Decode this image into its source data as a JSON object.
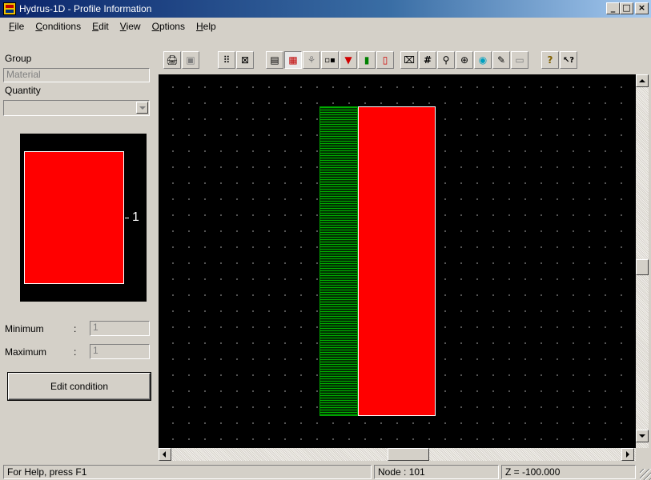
{
  "window": {
    "title": "Hydrus-1D - Profile Information",
    "controls": {
      "minimize": "_",
      "maximize": "□",
      "close": "×"
    }
  },
  "menu": {
    "items": [
      {
        "label": "File",
        "underline": "F",
        "rest": "ile"
      },
      {
        "label": "Conditions",
        "underline": "C",
        "rest": "onditions"
      },
      {
        "label": "Edit",
        "underline": "E",
        "rest": "dit"
      },
      {
        "label": "View",
        "underline": "V",
        "rest": "iew"
      },
      {
        "label": "Options",
        "underline": "O",
        "rest": "ptions"
      },
      {
        "label": "Help",
        "underline": "H",
        "rest": "elp"
      }
    ]
  },
  "left_panel": {
    "group_label": "Group",
    "group_value": "Material",
    "quantity_label": "Quantity",
    "quantity_value": "",
    "preview_number": "1",
    "minimum_label": "Minimum",
    "minimum_sep": ":",
    "minimum_value": "1",
    "maximum_label": "Maximum",
    "maximum_sep": ":",
    "maximum_value": "1",
    "edit_button": "Edit condition"
  },
  "toolbar": {
    "buttons": [
      {
        "icon": "print-icon",
        "glyph": "🖨"
      },
      {
        "icon": "save-icon",
        "glyph": "▣"
      },
      {
        "icon": "grid-dots-icon",
        "glyph": "⠿"
      },
      {
        "icon": "zoom-frame-icon",
        "glyph": "⊠"
      },
      {
        "icon": "profile-icon",
        "glyph": "▤"
      },
      {
        "icon": "material-distribution-icon",
        "glyph": "▦"
      },
      {
        "icon": "root-distribution-icon",
        "glyph": "⚘"
      },
      {
        "icon": "observation-nodes-icon",
        "glyph": "▫▪"
      },
      {
        "icon": "initial-condition-icon",
        "glyph": "▼"
      },
      {
        "icon": "sub-region-icon",
        "glyph": "▮"
      },
      {
        "icon": "temperature-icon",
        "glyph": "▯"
      },
      {
        "icon": "zoom-fit-icon",
        "glyph": "⌧"
      },
      {
        "icon": "grid-icon",
        "glyph": "#"
      },
      {
        "icon": "zoom-icon",
        "glyph": "⚲"
      },
      {
        "icon": "zoom-in-icon",
        "glyph": "⊕"
      },
      {
        "icon": "color-icon",
        "glyph": "◉"
      },
      {
        "icon": "pencil-icon",
        "glyph": "✎"
      },
      {
        "icon": "edit-box-icon",
        "glyph": "▭"
      },
      {
        "icon": "help-icon",
        "glyph": "?"
      },
      {
        "icon": "context-help-icon",
        "glyph": "↖?"
      }
    ]
  },
  "canvas": {
    "materials": [
      {
        "name": "hatched-column",
        "color": "#00b000"
      },
      {
        "name": "material-1",
        "color": "#ff0000"
      }
    ]
  },
  "status": {
    "help": "For Help, press F1",
    "node": "Node : 101",
    "z": "Z = -100.000"
  }
}
